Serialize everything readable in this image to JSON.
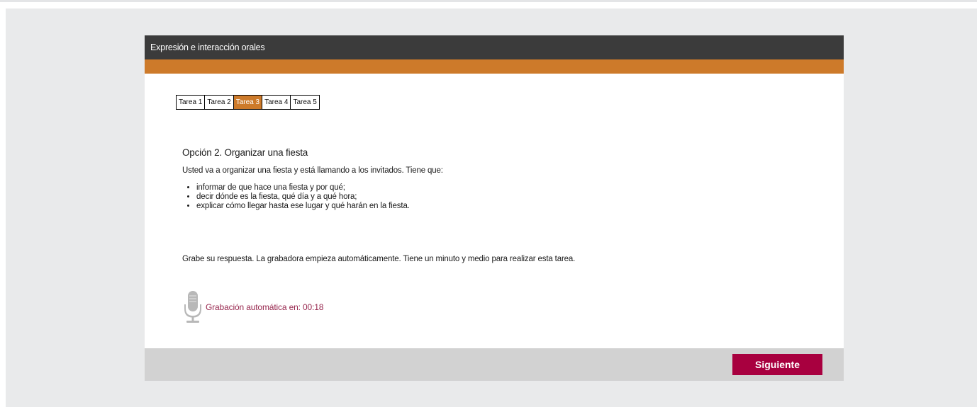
{
  "colors": {
    "header_bg": "#3b3b3b",
    "accent_orange": "#cd7a2a",
    "active_tab_bg": "#cd7a2a",
    "brand_crimson": "#a8003f",
    "countdown_text": "#98284f",
    "mic_gray": "#b8b8b8"
  },
  "header": {
    "title": "Expresión e interacción orales"
  },
  "tabs": [
    {
      "label": "Tarea 1",
      "active": false
    },
    {
      "label": "Tarea 2",
      "active": false
    },
    {
      "label": "Tarea 3",
      "active": true
    },
    {
      "label": "Tarea 4",
      "active": false
    },
    {
      "label": "Tarea 5",
      "active": false
    }
  ],
  "task": {
    "title": "Opción 2. Organizar una fiesta",
    "intro": "Usted va a organizar una fiesta y está llamando a los invitados. Tiene que:",
    "bullets": [
      "informar de que hace una fiesta y por qué;",
      "decir dónde es la fiesta, qué día y a qué hora;",
      "explicar cómo llegar hasta ese lugar y qué harán en la fiesta."
    ],
    "instruction": "Grabe su respuesta. La grabadora empieza automáticamente. Tiene un minuto y medio para realizar esta tarea."
  },
  "recorder": {
    "icon": "microphone-icon",
    "label": "Grabación automática en: 00:18"
  },
  "footer": {
    "next_label": "Siguiente"
  }
}
